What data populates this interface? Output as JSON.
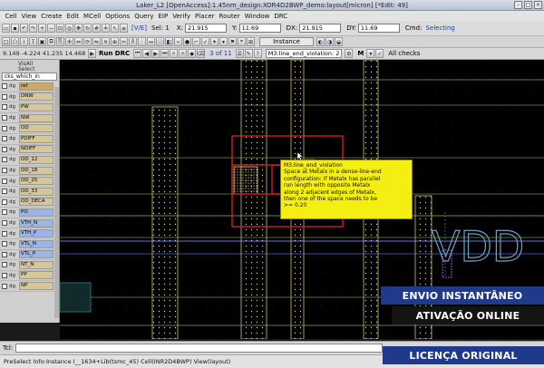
{
  "window": {
    "title": "Laker_L2 [OpenAccess]:1.45nm_design:XOR4D2BWP_demo:layout[micron] [*Edit: 49]"
  },
  "menu": [
    "Cell",
    "View",
    "Create",
    "Edit",
    "MCell",
    "Options",
    "Query",
    "EIP",
    "Verify",
    "Placer",
    "Router",
    "Window",
    "DRC"
  ],
  "toolbar": {
    "mode": "[V/E]",
    "select_label": "Sel: 1",
    "x_label": "X:",
    "x_value": "21.915",
    "y_label": "Y:",
    "y_value": "11.69",
    "dx_label": "DX:",
    "dx_value": "21.915",
    "dy_label": "DY:",
    "dy_value": "11.69",
    "cmd_label": "Cmd:",
    "cmd_value": "Selecting",
    "layer_combo": "Instance"
  },
  "drc_bar": {
    "coords": "9.149 -4.224 41.235 14.468",
    "run_label": "Run DRC",
    "pager": "3 of 11",
    "violation": "M3:line_end_violation: 2",
    "filter": "M",
    "all_checks": "All checks"
  },
  "left_panel": {
    "visall": "VisAll",
    "select": "Select",
    "filter_value": "cks_which_in",
    "layers": [
      {
        "dg": "dg",
        "name": "ref",
        "color": "#c9a86a",
        "checked": true
      },
      {
        "dg": "dg",
        "name": "DNW",
        "color": "#d6c79a",
        "checked": true
      },
      {
        "dg": "dg",
        "name": "PW",
        "color": "#d6c79a",
        "checked": true
      },
      {
        "dg": "dg",
        "name": "NW",
        "color": "#d6c79a",
        "checked": true
      },
      {
        "dg": "dg",
        "name": "OD",
        "color": "#d6c79a",
        "checked": true
      },
      {
        "dg": "dg",
        "name": "PDIFF",
        "color": "#d6c79a",
        "checked": true
      },
      {
        "dg": "dg",
        "name": "NDIFF",
        "color": "#d6c79a",
        "checked": true
      },
      {
        "dg": "dg",
        "name": "OD_12",
        "color": "#d6c79a",
        "checked": true
      },
      {
        "dg": "dg",
        "name": "OD_18",
        "color": "#d6c79a",
        "checked": true
      },
      {
        "dg": "dg",
        "name": "OD_25",
        "color": "#d6c79a",
        "checked": true
      },
      {
        "dg": "dg",
        "name": "OD_33",
        "color": "#d6c79a",
        "checked": true
      },
      {
        "dg": "dg",
        "name": "OD_DECA",
        "color": "#d6c79a",
        "checked": true
      },
      {
        "dg": "dg",
        "name": "PO",
        "color": "#9db4e6",
        "checked": true
      },
      {
        "dg": "dg",
        "name": "VTH_N",
        "color": "#9db4e6",
        "checked": true
      },
      {
        "dg": "dg",
        "name": "VTH_P",
        "color": "#9db4e6",
        "checked": true
      },
      {
        "dg": "dg",
        "name": "VTL_N",
        "color": "#9db4e6",
        "checked": true
      },
      {
        "dg": "dg",
        "name": "VTL_P",
        "color": "#9db4e6",
        "checked": true
      },
      {
        "dg": "dg",
        "name": "NT_N",
        "color": "#d6c79a",
        "checked": true
      },
      {
        "dg": "dg",
        "name": "PP",
        "color": "#d6c79a",
        "checked": true
      },
      {
        "dg": "dg",
        "name": "NP",
        "color": "#d6c79a",
        "checked": true
      }
    ]
  },
  "canvas": {
    "label_vdd": "VDD",
    "tooltip": {
      "title": "M3:line_end_violation",
      "lines": [
        "Space at Metalx in a dense-line-end",
        "configuration: If Metalx has parallel",
        "run length with opposite Metalx",
        "along 2 adjacent edges of Metalx,",
        "then one of the space needs to be",
        ">= 0.20"
      ]
    }
  },
  "command": {
    "label": "Tcl:"
  },
  "status": {
    "text": "PreSelect Info:Instance I__1634+Lib(tsmc_45) Cell(INR2D4BWP) View(layout)"
  },
  "banners": [
    {
      "text": "ENVIO INSTANTÂNEO",
      "bg": "#1f3a8a"
    },
    {
      "text": "ATIVAÇÃO ONLINE",
      "bg": "#141414"
    },
    {
      "text": "LICENÇA ORIGINAL",
      "bg": "#1f3a8a"
    }
  ]
}
